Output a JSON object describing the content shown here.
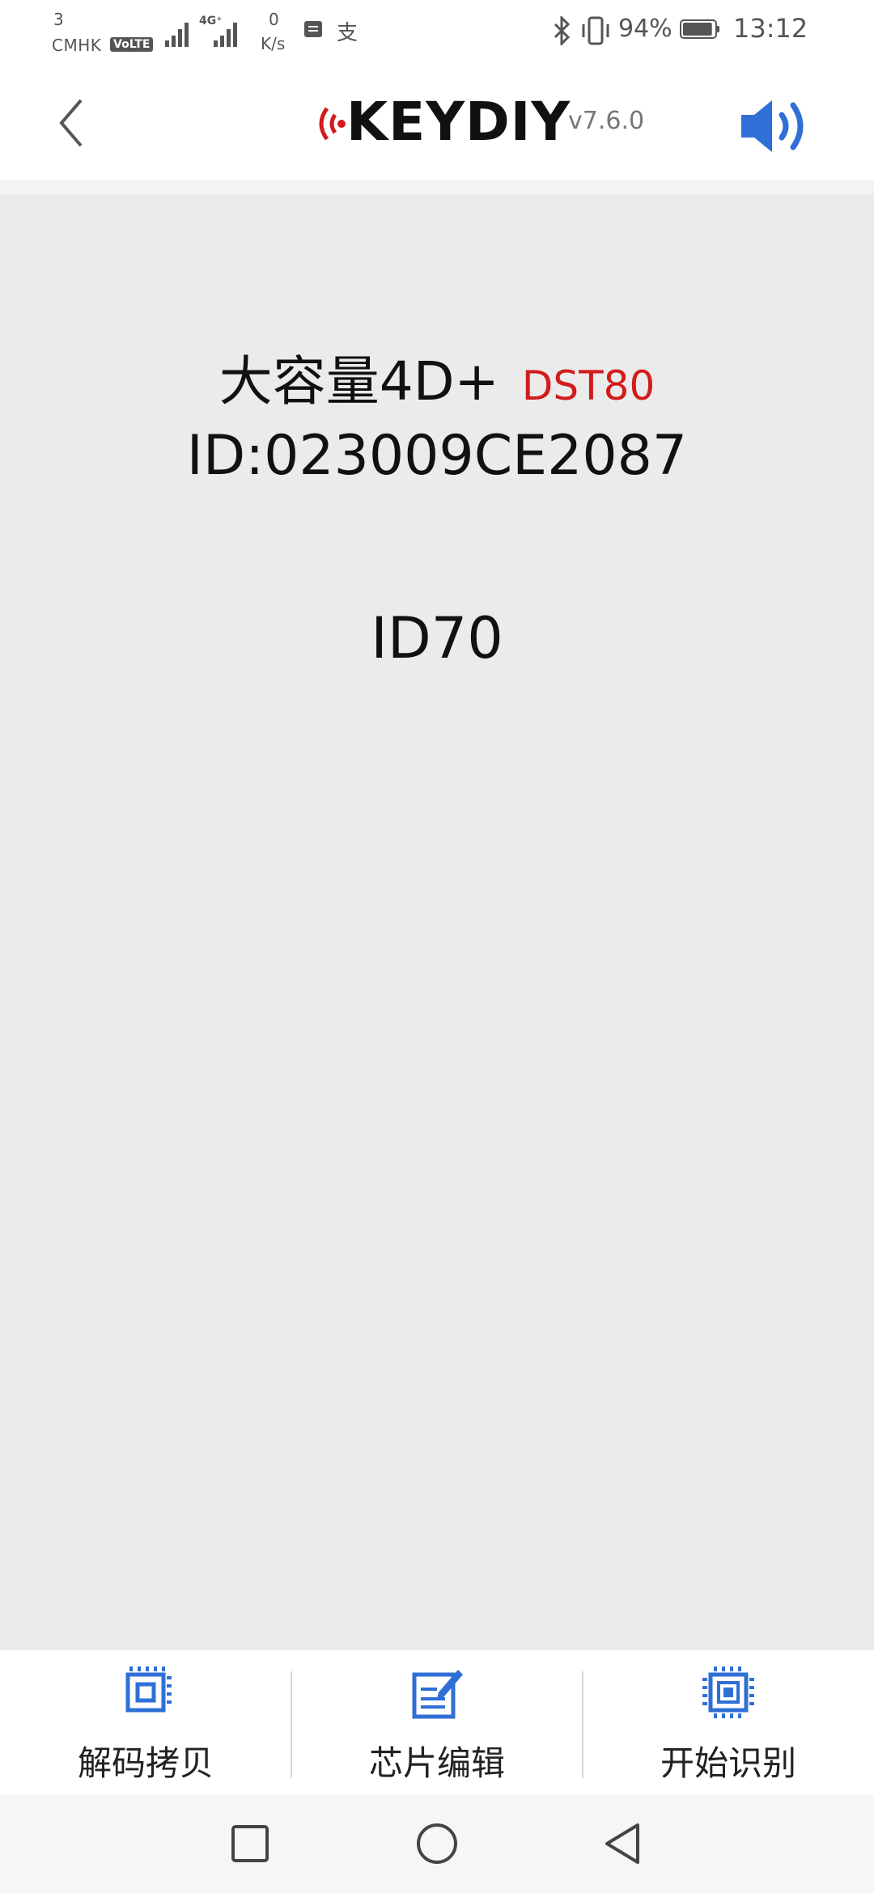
{
  "status_bar": {
    "sim_slot": "3",
    "carrier": "CMHK",
    "volte": "VoLTE",
    "network_type": "4G⁺",
    "speed_value": "0",
    "speed_unit": "K/s",
    "message_icon": "message-icon",
    "alipay_icon": "alipay-icon",
    "alipay_glyph": "支",
    "bluetooth_icon": "bluetooth-icon",
    "vibrate_icon": "vibrate-icon",
    "battery_percent": "94%",
    "battery_level": 0.94,
    "time": "13:12"
  },
  "header": {
    "back_icon": "chevron-left-icon",
    "brand_name": "KEYDIY",
    "version": "v7.6.0",
    "sound_icon": "speaker-icon",
    "brand_color": "#d21c1c",
    "accent_color": "#2f6fd6"
  },
  "chip": {
    "title": "大容量4D+",
    "model": "DST80",
    "id": "ID:023009CE2087",
    "type": "ID70"
  },
  "tabs": [
    {
      "label": "解码拷贝",
      "icon": "decode-copy-icon"
    },
    {
      "label": "芯片编辑",
      "icon": "chip-edit-icon"
    },
    {
      "label": "开始识别",
      "icon": "start-identify-icon"
    }
  ],
  "nav": {
    "recents_icon": "square-recents-icon",
    "home_icon": "circle-home-icon",
    "back_icon": "triangle-back-icon"
  }
}
